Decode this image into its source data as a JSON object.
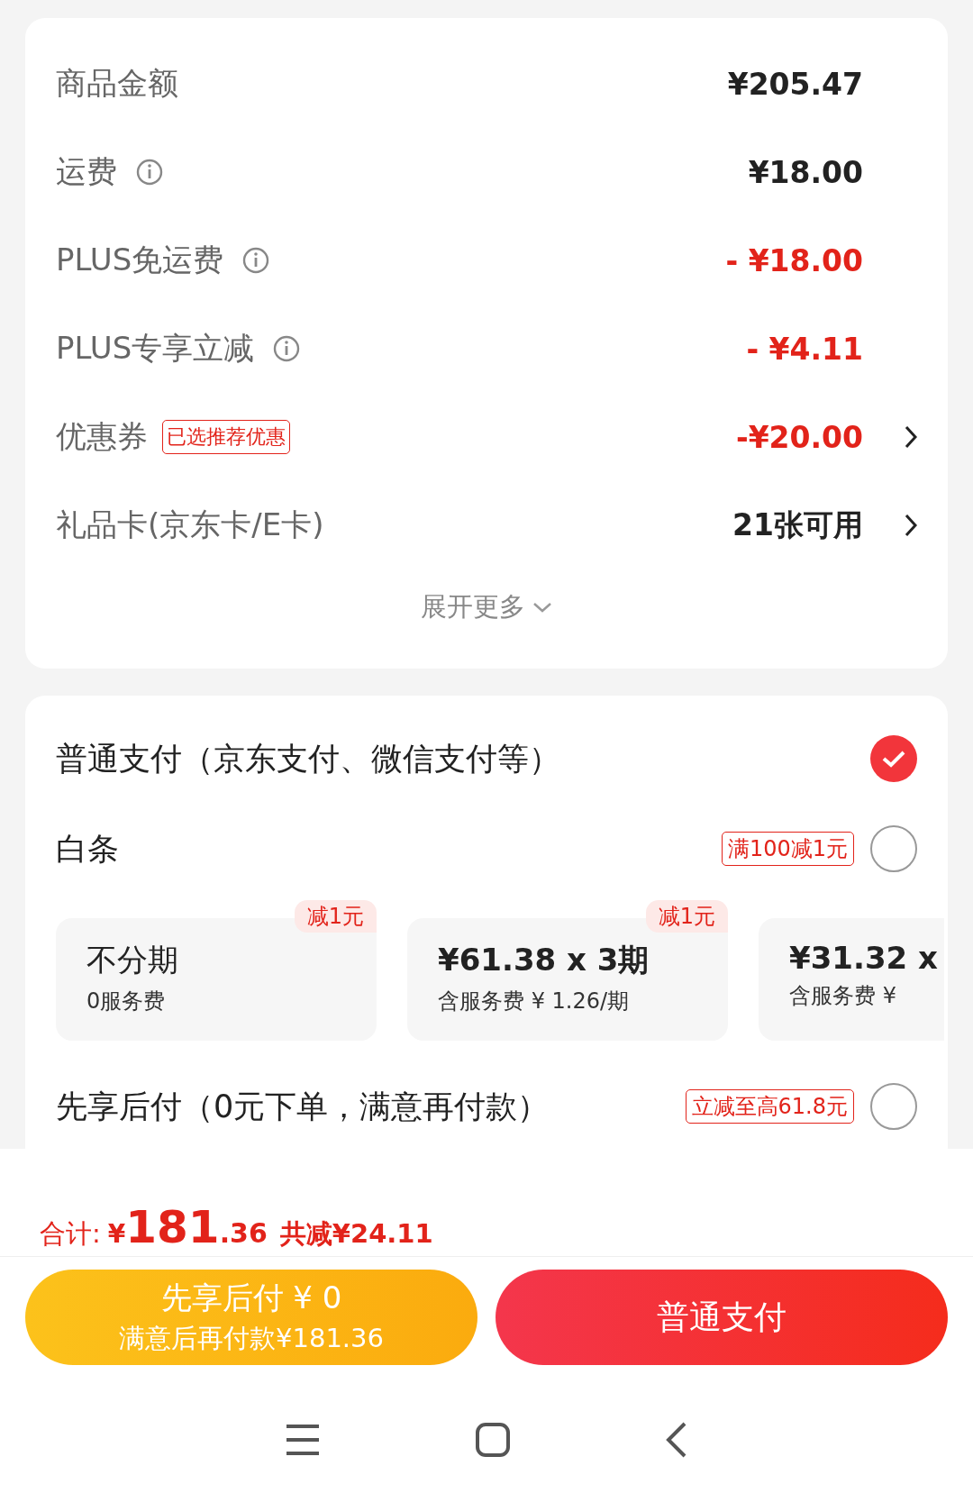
{
  "fees": [
    {
      "label": "商品金额",
      "info": false,
      "value": "¥205.47",
      "discount": false,
      "chevron": false
    },
    {
      "label": "运费",
      "info": true,
      "value": "¥18.00",
      "discount": false,
      "chevron": false
    },
    {
      "label": "PLUS免运费",
      "info": true,
      "value": "- ¥18.00",
      "discount": true,
      "chevron": false
    },
    {
      "label": "PLUS专享立减",
      "info": true,
      "value": "- ¥4.11",
      "discount": true,
      "chevron": false
    },
    {
      "label": "优惠券",
      "info": false,
      "tag": "已选推荐优惠",
      "value": "-¥20.00",
      "discount": true,
      "chevron": true
    },
    {
      "label": "礼品卡(京东卡/E卡)",
      "info": false,
      "value": "21张可用",
      "discount": false,
      "chevron": true
    }
  ],
  "expand": "展开更多",
  "payments": [
    {
      "label": "普通支付（京东支付、微信支付等）",
      "selected": true
    },
    {
      "label": "白条",
      "badge": "满100减1元",
      "selected": false,
      "installments": [
        {
          "title": "不分期",
          "note": "0服务费",
          "badge": "减1元"
        },
        {
          "title": "¥61.38 x 3期",
          "note": "含服务费 ¥ 1.26/期",
          "badge": "减1元"
        },
        {
          "title": "¥31.32 x",
          "note": "含服务费 ¥"
        }
      ]
    },
    {
      "label": "先享后付（0元下单，满意再付款）",
      "badge": "立减至高61.8元",
      "selected": false
    }
  ],
  "total": {
    "label": "合计:",
    "currency": "¥",
    "integer": "181",
    "decimal": ".36",
    "saved": "共减¥24.11"
  },
  "buttons": [
    {
      "kind": "later",
      "title": "先享后付 ¥ 0",
      "subtitle": "满意后再付款¥181.36"
    },
    {
      "kind": "pay",
      "title": "普通支付"
    }
  ]
}
